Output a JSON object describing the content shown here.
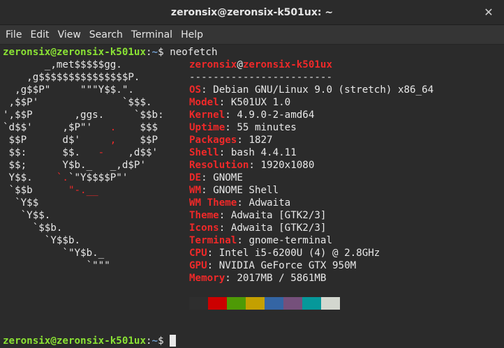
{
  "window": {
    "title": "zeronsix@zeronsix-k501ux: ~",
    "close_glyph": "✕"
  },
  "menu": [
    "File",
    "Edit",
    "View",
    "Search",
    "Terminal",
    "Help"
  ],
  "prompt": {
    "user_host": "zeronsix@zeronsix-k501ux",
    "sep": ":",
    "path": "~",
    "dollar": "$ ",
    "command": "neofetch"
  },
  "logo": [
    {
      "w": "       _,met$$$$$gg."
    },
    {
      "w": "    ,g$$$$$$$$$$$$$$$P."
    },
    {
      "w": "  ,g$$P\"     \"\"\"Y$$.\"."
    },
    {
      "w": " ,$$P'              `$$$."
    },
    {
      "w": "',$$P       ,ggs.     `$$b:"
    },
    {
      "w": "`d$$'     ,$P\"'   ",
      "r": ".",
      "w2": "    $$$"
    },
    {
      "w": " $$P      d$'     ",
      "r": ",",
      "w2": "    $$P"
    },
    {
      "w": " $$:      $$.   ",
      "r": "-",
      "w2": "    ,d$$'"
    },
    {
      "w": " $$;      Y$b._   _,d$P'"
    },
    {
      "w": " Y$$.    ",
      "r": "`.",
      "w2": "`\"Y$$$$P\"'"
    },
    {
      "w": " `$$b      ",
      "r": "\"-.__"
    },
    {
      "w": "  `Y$$"
    },
    {
      "w": "   `Y$$."
    },
    {
      "w": "     `$$b."
    },
    {
      "w": "       `Y$$b."
    },
    {
      "w": "          `\"Y$b._"
    },
    {
      "w": "              `\"\"\""
    }
  ],
  "info": {
    "header_user": "zeronsix",
    "header_at": "@",
    "header_host": "zeronsix-k501ux",
    "divider": "------------------------",
    "fields": [
      {
        "key": "OS",
        "value": "Debian GNU/Linux 9.0 (stretch) x86_64"
      },
      {
        "key": "Model",
        "value": "K501UX 1.0"
      },
      {
        "key": "Kernel",
        "value": "4.9.0-2-amd64"
      },
      {
        "key": "Uptime",
        "value": "55 minutes"
      },
      {
        "key": "Packages",
        "value": "1827"
      },
      {
        "key": "Shell",
        "value": "bash 4.4.11"
      },
      {
        "key": "Resolution",
        "value": "1920x1080"
      },
      {
        "key": "DE",
        "value": "GNOME"
      },
      {
        "key": "WM",
        "value": "GNOME Shell"
      },
      {
        "key": "WM Theme",
        "value": "Adwaita"
      },
      {
        "key": "Theme",
        "value": "Adwaita [GTK2/3]"
      },
      {
        "key": "Icons",
        "value": "Adwaita [GTK2/3]"
      },
      {
        "key": "Terminal",
        "value": "gnome-terminal"
      },
      {
        "key": "CPU",
        "value": "Intel i5-6200U (4) @ 2.8GHz"
      },
      {
        "key": "GPU",
        "value": "NVIDIA GeForce GTX 950M"
      },
      {
        "key": "Memory",
        "value": "2017MB / 5861MB"
      }
    ],
    "key_sep": ": "
  },
  "palette": [
    "#2e2e2e",
    "#cc0000",
    "#4e9a06",
    "#c4a000",
    "#3465a4",
    "#75507b",
    "#06989a",
    "#d3d7cf"
  ],
  "colors": {
    "prompt_user": "#8ae234",
    "prompt_path": "#729fcf",
    "key_red": "#ef2929",
    "background": "#2b2b2b"
  }
}
